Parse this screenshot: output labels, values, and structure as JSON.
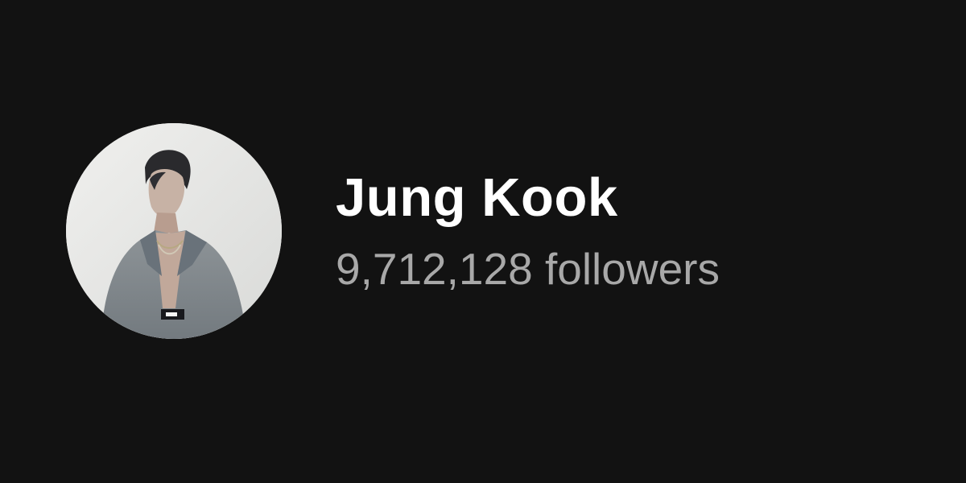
{
  "artist": {
    "name": "Jung Kook",
    "followers_text": "9,712,128 followers",
    "avatar_icon": "artist-photo"
  },
  "colors": {
    "background": "#121212",
    "name": "#ffffff",
    "subtext": "#a8a8a8"
  }
}
